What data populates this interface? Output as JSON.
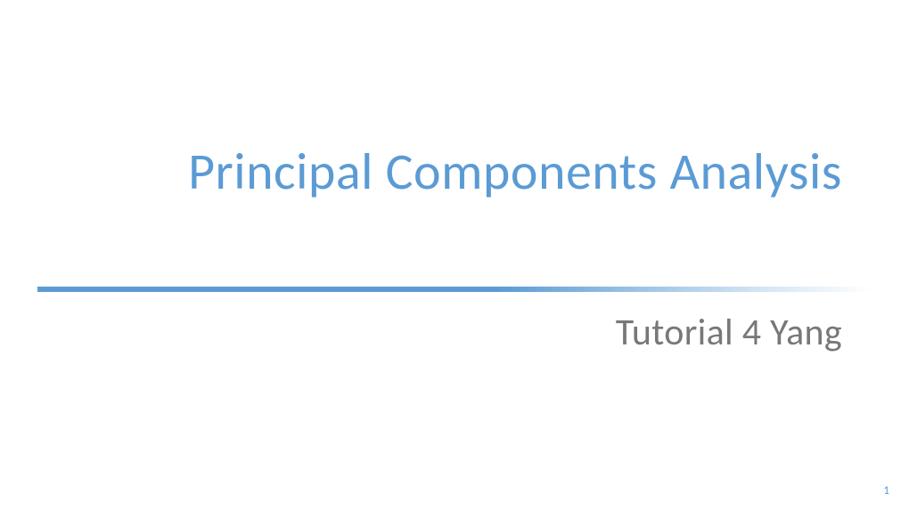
{
  "slide": {
    "title": "Principal Components Analysis",
    "subtitle": "Tutorial 4 Yang",
    "page_number": "1"
  },
  "colors": {
    "accent": "#5b9bd5",
    "subtitle_gray": "#787878"
  }
}
